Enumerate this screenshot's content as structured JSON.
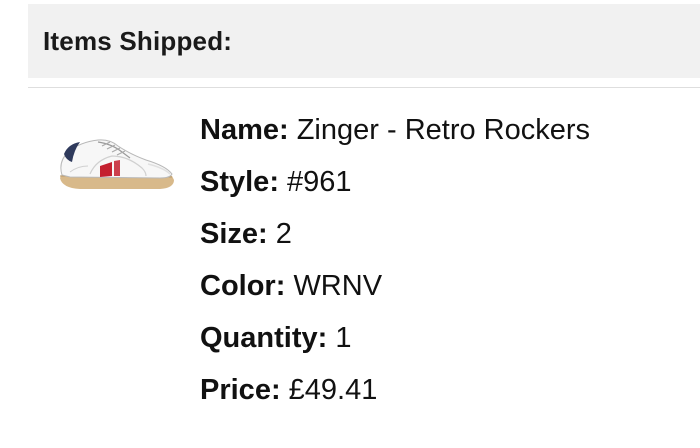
{
  "section": {
    "title": "Items Shipped:"
  },
  "item": {
    "image_icon": "sneaker-product-image",
    "fields": [
      {
        "label": "Name:",
        "value": "Zinger - Retro Rockers"
      },
      {
        "label": "Style:",
        "value": "#961"
      },
      {
        "label": "Size:",
        "value": "2"
      },
      {
        "label": "Color:",
        "value": "WRNV"
      },
      {
        "label": "Quantity:",
        "value": "1"
      },
      {
        "label": "Price:",
        "value": "£49.41"
      }
    ]
  },
  "colors": {
    "header_background": "#f1f1f1",
    "shoe_stripe": "#c4202f",
    "shoe_accent": "#2f3a5c",
    "sole": "#d8b98a"
  }
}
